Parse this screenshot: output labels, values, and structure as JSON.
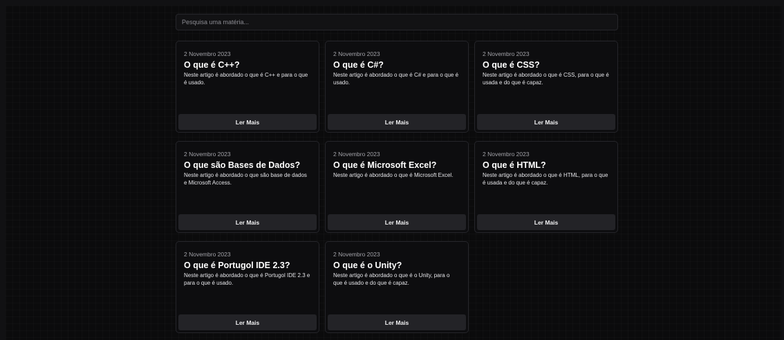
{
  "search": {
    "placeholder": "Pesquisa uma matéria..."
  },
  "articles": [
    {
      "date": "2 Novembro 2023",
      "title": "O que é C++?",
      "description": "Neste artigo é abordado o que é C++ e para o que é usado.",
      "button_label": "Ler Mais"
    },
    {
      "date": "2 Novembro 2023",
      "title": "O que é C#?",
      "description": "Neste artigo é abordado o que é C# e para o que é usado.",
      "button_label": "Ler Mais"
    },
    {
      "date": "2 Novembro 2023",
      "title": "O que é CSS?",
      "description": "Neste artigo é abordado o que é CSS, para o que é usada e do que é capaz.",
      "button_label": "Ler Mais"
    },
    {
      "date": "2 Novembro 2023",
      "title": "O que são Bases de Dados?",
      "description": "Neste artigo é abordado o que são base de dados e Microsoft Access.",
      "button_label": "Ler Mais"
    },
    {
      "date": "2 Novembro 2023",
      "title": "O que é Microsoft Excel?",
      "description": "Neste artigo é abordado o que é Microsoft Excel.",
      "button_label": "Ler Mais"
    },
    {
      "date": "2 Novembro 2023",
      "title": "O que é HTML?",
      "description": "Neste artigo é abordado o que é HTML, para o que é usada e do que é capaz.",
      "button_label": "Ler Mais"
    },
    {
      "date": "2 Novembro 2023",
      "title": "O que é Portugol IDE 2.3?",
      "description": "Neste artigo é abordado o que é Portugol IDE 2.3 e para o que é usado.",
      "button_label": "Ler Mais"
    },
    {
      "date": "2 Novembro 2023",
      "title": "O que é o Unity?",
      "description": "Neste artigo é abordado o que é o Unity, para o que é usado e do que é capaz.",
      "button_label": "Ler Mais"
    }
  ]
}
